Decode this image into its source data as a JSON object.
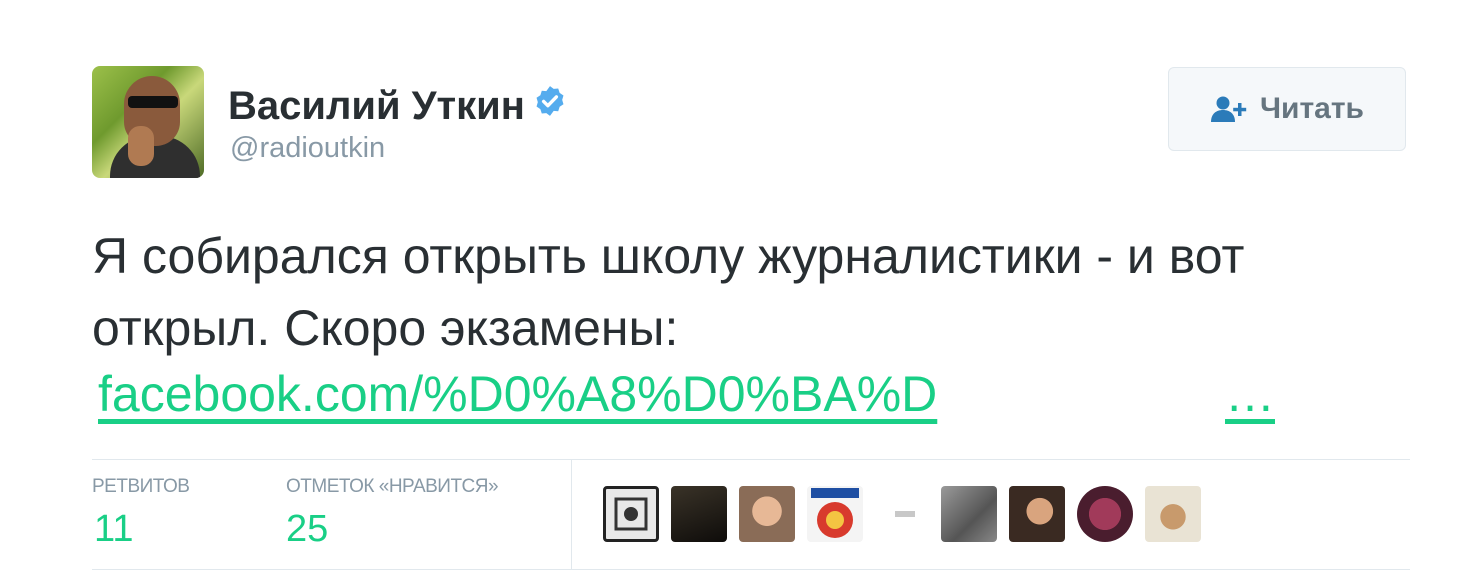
{
  "user": {
    "name": "Василий Уткин",
    "handle": "@radioutkin",
    "verified": true
  },
  "follow_button": {
    "label": "Читать",
    "icon": "add-user-icon"
  },
  "tweet": {
    "text": "Я собирался открыть школу журналистики - и вот открыл. Скоро экзамены:",
    "link": "facebook.com/%D0%A8%D0%BA%D",
    "link_ellipsis": "…"
  },
  "stats": {
    "retweets_label": "РЕТВИТОВ",
    "retweets_value": "11",
    "likes_label": "ОТМЕТОК «НРАВИТСЯ»",
    "likes_value": "25"
  },
  "colors": {
    "accent": "#19cf86",
    "verified": "#55acee",
    "text": "#292f33",
    "muted": "#8899a6"
  },
  "likers": [
    {
      "name": "liker-avatar-1"
    },
    {
      "name": "liker-avatar-2"
    },
    {
      "name": "liker-avatar-3"
    },
    {
      "name": "liker-avatar-4"
    },
    {
      "name": "liker-avatar-5"
    },
    {
      "name": "liker-avatar-6"
    },
    {
      "name": "liker-avatar-7"
    },
    {
      "name": "liker-avatar-8"
    },
    {
      "name": "liker-avatar-9"
    }
  ]
}
